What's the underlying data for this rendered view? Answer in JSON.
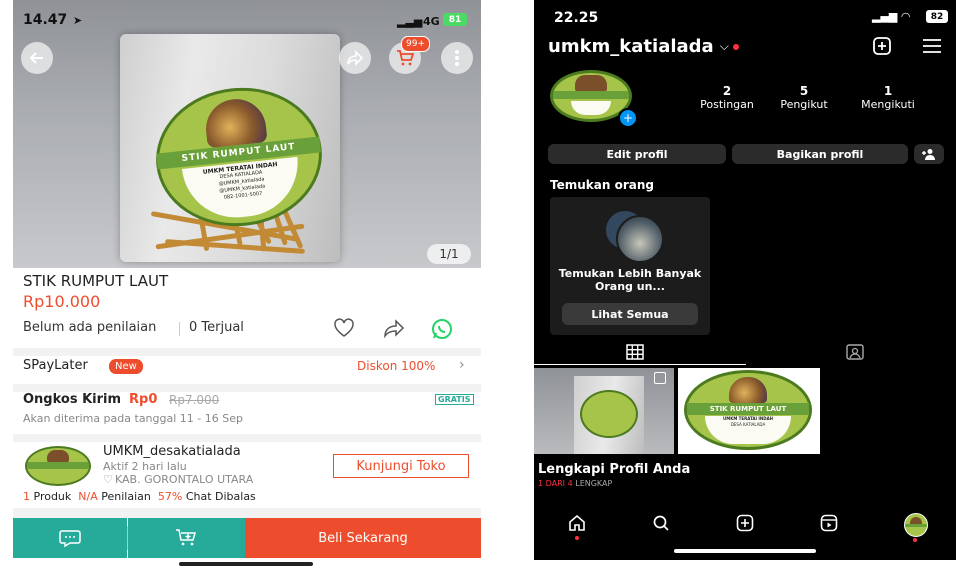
{
  "shopee": {
    "status": {
      "time": "14.47",
      "signal": "4G",
      "battery": "81"
    },
    "cart_badge": "99+",
    "photo_counter": "1/1",
    "product": {
      "label_title": "STIK RUMPUT LAUT",
      "label_brand": "UMKM TERATAI INDAH",
      "label_village": "DESA KATIALADA",
      "label_handle1": "@UMKM_katialada",
      "label_handle2": "@UMKM_katialada",
      "label_phone": "082-1001-5007",
      "name": "STIK RUMPUT LAUT",
      "price": "Rp10.000",
      "rating": "Belum ada penilaian",
      "sold": "0 Terjual"
    },
    "spaylater": {
      "label": "SPayLater",
      "badge": "New",
      "promo": "Diskon 100%"
    },
    "shipping": {
      "label": "Ongkos Kirim",
      "price": "Rp0",
      "old_price": "Rp7.000",
      "tag": "GRATIS",
      "eta": "Akan diterima pada tanggal 11 - 16 Sep"
    },
    "shop": {
      "name": "UMKM_desakatialada",
      "active": "Aktif 2 hari lalu",
      "location": "KAB. GORONTALO UTARA",
      "visit_button": "Kunjungi Toko",
      "products_count": "1",
      "products_label": "Produk",
      "rating_value": "N/A",
      "rating_label": "Penilaian",
      "chat_value": "57%",
      "chat_label": "Chat Dibalas"
    },
    "bottom": {
      "buy_now": "Beli Sekarang"
    },
    "colors": {
      "orange": "#ee4d2d",
      "teal": "#26aa99",
      "whatsapp": "#25d366"
    },
    "icons": [
      "back-arrow-icon",
      "share-icon",
      "cart-icon",
      "more-icon",
      "heart-icon",
      "whatsapp-icon",
      "chat-icon",
      "add-to-cart-icon",
      "location-pin-icon",
      "chevron-right-icon"
    ]
  },
  "instagram": {
    "status": {
      "time": "22.25",
      "battery": "82"
    },
    "username": "umkm_katialada",
    "stats": [
      {
        "value": "2",
        "label": "Postingan"
      },
      {
        "value": "5",
        "label": "Pengikut"
      },
      {
        "value": "1",
        "label": "Mengikuti"
      }
    ],
    "buttons": {
      "edit": "Edit profil",
      "share": "Bagikan profil"
    },
    "discover": {
      "heading": "Temukan orang",
      "card_text": "Temukan Lebih Banyak Orang un...",
      "card_button": "Lihat Semua"
    },
    "posts": {
      "label_title": "STIK RUMPUT LAUT",
      "label_brand": "UMKM TERATAI INDAH",
      "label_village": "DESA KATIALADA"
    },
    "complete": {
      "title": "Lengkapi Profil Anda",
      "progress_prefix": "1 DARI 4",
      "progress_suffix": "LENGKAP"
    },
    "icons": [
      "chevron-down-icon",
      "new-post-icon",
      "menu-icon",
      "add-person-icon",
      "grid-icon",
      "tagged-icon",
      "home-icon",
      "search-icon",
      "create-icon",
      "reels-icon",
      "profile-avatar-icon"
    ]
  }
}
